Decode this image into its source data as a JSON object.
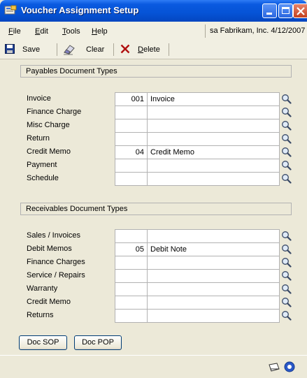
{
  "window": {
    "title": "Voucher Assignment Setup"
  },
  "menu": {
    "items": [
      {
        "label": "File",
        "accel": "F",
        "rest": "ile"
      },
      {
        "label": "Edit",
        "accel": "E",
        "rest": "dit"
      },
      {
        "label": "Tools",
        "accel": "T",
        "rest": "ools"
      },
      {
        "label": "Help",
        "accel": "H",
        "rest": "elp"
      }
    ],
    "user_info": "sa  Fabrikam, Inc.  4/12/2007"
  },
  "toolbar": {
    "save_label": "Save",
    "clear_label": "Clear",
    "delete_label": "Delete"
  },
  "payables": {
    "header": "Payables Document Types",
    "rows": [
      {
        "label": "Invoice",
        "code": "001",
        "description": "Invoice"
      },
      {
        "label": "Finance Charge",
        "code": "",
        "description": ""
      },
      {
        "label": "Misc Charge",
        "code": "",
        "description": ""
      },
      {
        "label": "Return",
        "code": "",
        "description": ""
      },
      {
        "label": "Credit  Memo",
        "code": "04",
        "description": "Credit Memo"
      },
      {
        "label": "Payment",
        "code": "",
        "description": ""
      },
      {
        "label": "Schedule",
        "code": "",
        "description": ""
      }
    ]
  },
  "receivables": {
    "header": "Receivables Document Types",
    "rows": [
      {
        "label": "Sales / Invoices",
        "code": "",
        "description": ""
      },
      {
        "label": "Debit Memos",
        "code": "05",
        "description": "Debit Note"
      },
      {
        "label": "Finance Charges",
        "code": "",
        "description": ""
      },
      {
        "label": "Service / Repairs",
        "code": "",
        "description": ""
      },
      {
        "label": "Warranty",
        "code": "",
        "description": ""
      },
      {
        "label": "Credit Memo",
        "code": "",
        "description": ""
      },
      {
        "label": "Returns",
        "code": "",
        "description": ""
      }
    ]
  },
  "buttons": {
    "doc_sop": "Doc SOP",
    "doc_pop": "Doc POP"
  },
  "icons": {
    "title": "window-app-icon",
    "lookup": "magnifier-lookup-icon",
    "note": "note-icon",
    "help": "help-icon"
  }
}
